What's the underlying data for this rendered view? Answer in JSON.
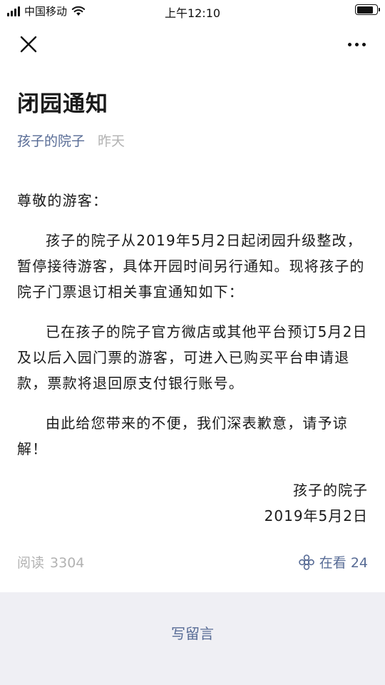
{
  "status_bar": {
    "carrier": "中国移动",
    "time": "上午12:10",
    "battery_level": 0.85
  },
  "nav": {
    "close_icon": "close-icon",
    "more_icon": "more-icon"
  },
  "article": {
    "title": "闭园通知",
    "author": "孩子的院子",
    "date": "昨天",
    "greeting": "尊敬的游客：",
    "paragraphs": [
      "孩子的院子从2019年5月2日起闭园升级整改，暂停接待游客，具体开园时间另行通知。现将孩子的院子门票退订相关事宜通知如下：",
      "已在孩子的院子官方微店或其他平台预订5月2日及以后入园门票的游客，可进入已购买平台申请退款，票款将退回原支付银行账号。",
      "由此给您带来的不便，我们深表歉意，请予谅解！"
    ],
    "signature_org": "孩子的院子",
    "signature_date": "2019年5月2日"
  },
  "stats": {
    "reads_label": "阅读",
    "reads_count": "3304",
    "watching_label": "在看 24"
  },
  "comment": {
    "write_label": "写留言"
  },
  "colors": {
    "link": "#576b95",
    "muted": "#b2b2b2",
    "footer_bg": "#efeff4"
  }
}
